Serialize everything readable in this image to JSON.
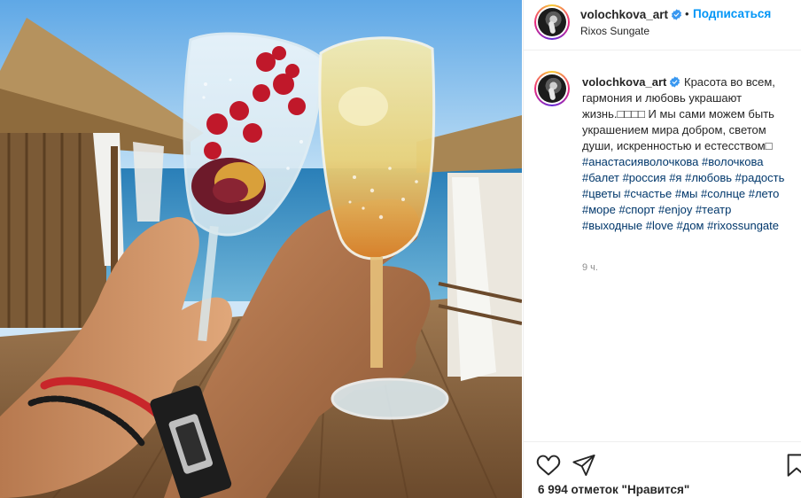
{
  "post": {
    "username": "volochkova_art",
    "dot": "•",
    "follow_label": "Подписаться",
    "location": "Rixos Sungate",
    "caption_text_1": "Красота во всем, гармония и любовь украшают жизнь.",
    "caption_emoji_1": "□□□□",
    "caption_text_2": " И мы сами можем быть украшением мира добром, светом души, искренностью и естесством",
    "caption_emoji_2": "□",
    "hashtags": [
      "#анастасияволочкова",
      "#волочкова",
      "#балет",
      "#россия",
      "#я",
      "#любовь",
      "#радость",
      "#цветы",
      "#счастье",
      "#мы",
      "#солнце",
      "#лето",
      "#море",
      "#спорт",
      "#enjoy",
      "#театр",
      "#выходные",
      "#love",
      "#дом",
      "#rixossungate"
    ],
    "timestamp": "9 ч.",
    "likes": "6 994 отметок \"Нравится\""
  },
  "icons": {
    "verified": "verified-badge-icon",
    "like": "heart-icon",
    "share": "paper-plane-icon",
    "save": "bookmark-icon"
  },
  "colors": {
    "link_blue": "#0095f6",
    "hashtag": "#00376b",
    "verified": "#3897f0",
    "muted": "#8e8e8e"
  }
}
